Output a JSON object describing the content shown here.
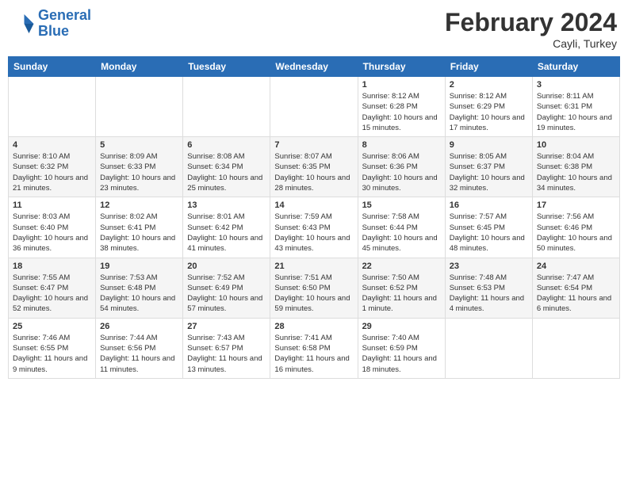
{
  "header": {
    "logo_line1": "General",
    "logo_line2": "Blue",
    "month_year": "February 2024",
    "location": "Cayli, Turkey"
  },
  "weekdays": [
    "Sunday",
    "Monday",
    "Tuesday",
    "Wednesday",
    "Thursday",
    "Friday",
    "Saturday"
  ],
  "weeks": [
    [
      {
        "day": "",
        "info": ""
      },
      {
        "day": "",
        "info": ""
      },
      {
        "day": "",
        "info": ""
      },
      {
        "day": "",
        "info": ""
      },
      {
        "day": "1",
        "info": "Sunrise: 8:12 AM\nSunset: 6:28 PM\nDaylight: 10 hours and 15 minutes."
      },
      {
        "day": "2",
        "info": "Sunrise: 8:12 AM\nSunset: 6:29 PM\nDaylight: 10 hours and 17 minutes."
      },
      {
        "day": "3",
        "info": "Sunrise: 8:11 AM\nSunset: 6:31 PM\nDaylight: 10 hours and 19 minutes."
      }
    ],
    [
      {
        "day": "4",
        "info": "Sunrise: 8:10 AM\nSunset: 6:32 PM\nDaylight: 10 hours and 21 minutes."
      },
      {
        "day": "5",
        "info": "Sunrise: 8:09 AM\nSunset: 6:33 PM\nDaylight: 10 hours and 23 minutes."
      },
      {
        "day": "6",
        "info": "Sunrise: 8:08 AM\nSunset: 6:34 PM\nDaylight: 10 hours and 25 minutes."
      },
      {
        "day": "7",
        "info": "Sunrise: 8:07 AM\nSunset: 6:35 PM\nDaylight: 10 hours and 28 minutes."
      },
      {
        "day": "8",
        "info": "Sunrise: 8:06 AM\nSunset: 6:36 PM\nDaylight: 10 hours and 30 minutes."
      },
      {
        "day": "9",
        "info": "Sunrise: 8:05 AM\nSunset: 6:37 PM\nDaylight: 10 hours and 32 minutes."
      },
      {
        "day": "10",
        "info": "Sunrise: 8:04 AM\nSunset: 6:38 PM\nDaylight: 10 hours and 34 minutes."
      }
    ],
    [
      {
        "day": "11",
        "info": "Sunrise: 8:03 AM\nSunset: 6:40 PM\nDaylight: 10 hours and 36 minutes."
      },
      {
        "day": "12",
        "info": "Sunrise: 8:02 AM\nSunset: 6:41 PM\nDaylight: 10 hours and 38 minutes."
      },
      {
        "day": "13",
        "info": "Sunrise: 8:01 AM\nSunset: 6:42 PM\nDaylight: 10 hours and 41 minutes."
      },
      {
        "day": "14",
        "info": "Sunrise: 7:59 AM\nSunset: 6:43 PM\nDaylight: 10 hours and 43 minutes."
      },
      {
        "day": "15",
        "info": "Sunrise: 7:58 AM\nSunset: 6:44 PM\nDaylight: 10 hours and 45 minutes."
      },
      {
        "day": "16",
        "info": "Sunrise: 7:57 AM\nSunset: 6:45 PM\nDaylight: 10 hours and 48 minutes."
      },
      {
        "day": "17",
        "info": "Sunrise: 7:56 AM\nSunset: 6:46 PM\nDaylight: 10 hours and 50 minutes."
      }
    ],
    [
      {
        "day": "18",
        "info": "Sunrise: 7:55 AM\nSunset: 6:47 PM\nDaylight: 10 hours and 52 minutes."
      },
      {
        "day": "19",
        "info": "Sunrise: 7:53 AM\nSunset: 6:48 PM\nDaylight: 10 hours and 54 minutes."
      },
      {
        "day": "20",
        "info": "Sunrise: 7:52 AM\nSunset: 6:49 PM\nDaylight: 10 hours and 57 minutes."
      },
      {
        "day": "21",
        "info": "Sunrise: 7:51 AM\nSunset: 6:50 PM\nDaylight: 10 hours and 59 minutes."
      },
      {
        "day": "22",
        "info": "Sunrise: 7:50 AM\nSunset: 6:52 PM\nDaylight: 11 hours and 1 minute."
      },
      {
        "day": "23",
        "info": "Sunrise: 7:48 AM\nSunset: 6:53 PM\nDaylight: 11 hours and 4 minutes."
      },
      {
        "day": "24",
        "info": "Sunrise: 7:47 AM\nSunset: 6:54 PM\nDaylight: 11 hours and 6 minutes."
      }
    ],
    [
      {
        "day": "25",
        "info": "Sunrise: 7:46 AM\nSunset: 6:55 PM\nDaylight: 11 hours and 9 minutes."
      },
      {
        "day": "26",
        "info": "Sunrise: 7:44 AM\nSunset: 6:56 PM\nDaylight: 11 hours and 11 minutes."
      },
      {
        "day": "27",
        "info": "Sunrise: 7:43 AM\nSunset: 6:57 PM\nDaylight: 11 hours and 13 minutes."
      },
      {
        "day": "28",
        "info": "Sunrise: 7:41 AM\nSunset: 6:58 PM\nDaylight: 11 hours and 16 minutes."
      },
      {
        "day": "29",
        "info": "Sunrise: 7:40 AM\nSunset: 6:59 PM\nDaylight: 11 hours and 18 minutes."
      },
      {
        "day": "",
        "info": ""
      },
      {
        "day": "",
        "info": ""
      }
    ]
  ]
}
